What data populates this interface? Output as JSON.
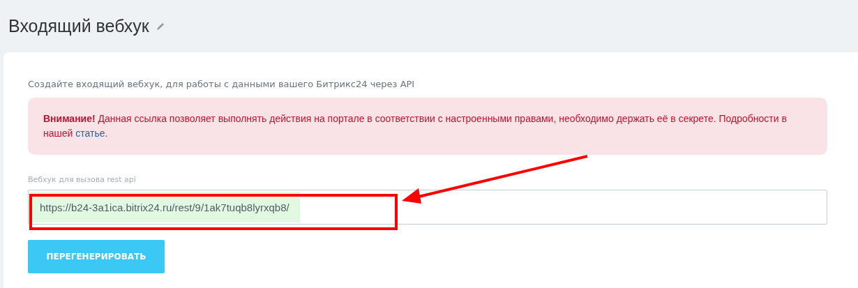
{
  "title": "Входящий вебхук",
  "description": "Создайте входящий вебхук, для работы с данными вашего Битрикс24 через API",
  "alert": {
    "text": "**Внимание!** Данная ссылка позволяет выполнять действия на портале в соответствии с настроенными правами, необходимо держать её в секрете. Подробности в нашей ",
    "link": "статье",
    "end": "."
  },
  "field": {
    "label": "Вебхук для вызова rest api",
    "value": "https://b24-3a1ica.bitrix24.ru/rest/9/1ak7tuqb8lyrxqb8/"
  },
  "button": "ПЕРЕГЕНЕРИРОВАТЬ"
}
